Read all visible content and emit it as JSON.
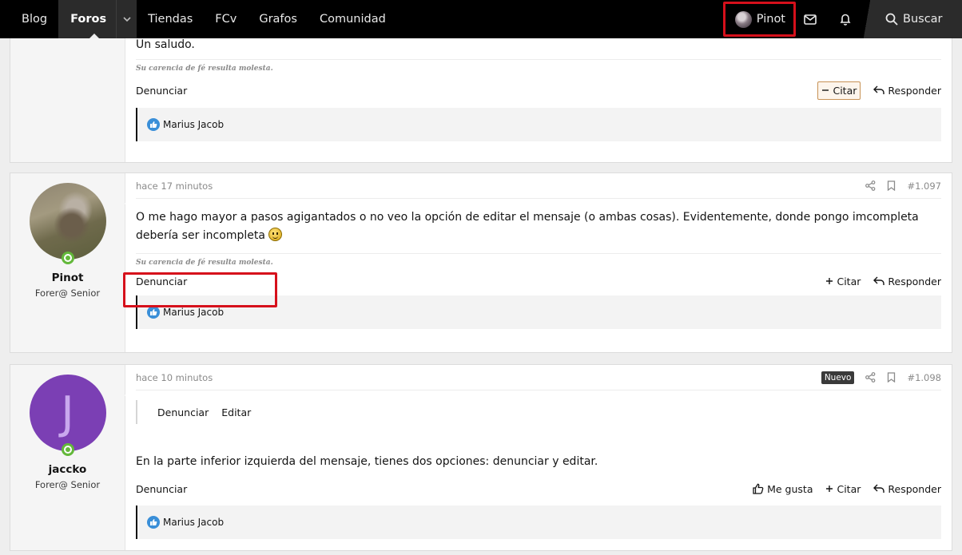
{
  "nav": {
    "items": [
      "Blog",
      "Foros",
      "Tiendas",
      "FCv",
      "Grafos",
      "Comunidad"
    ],
    "active": "Foros",
    "user": "Pinot",
    "search": "Buscar"
  },
  "posts": [
    {
      "message": "Un saludo.",
      "signature": "Su carencia de fé resulta molesta.",
      "report": "Denunciar",
      "quote": "Citar",
      "reply": "Responder",
      "reaction_user": "Marius Jacob"
    },
    {
      "username": "Pinot",
      "user_title": "Forer@ Senior",
      "time": "hace 17 minutos",
      "number": "#1.097",
      "message": "O me hago mayor a pasos agigantados o no veo la opción de editar el mensaje (o ambas cosas). Evidentemente, donde pongo imcompleta debería ser incompleta",
      "signature": "Su carencia de fé resulta molesta.",
      "report": "Denunciar",
      "quote": "Citar",
      "reply": "Responder",
      "reaction_user": "Marius Jacob"
    },
    {
      "username": "jaccko",
      "user_title": "Forer@ Senior",
      "avatar_letter": "J",
      "time": "hace 10 minutos",
      "badge": "Nuevo",
      "number": "#1.098",
      "quoted_menu": [
        "Denunciar",
        "Editar"
      ],
      "message": "En la parte inferior izquierda del mensaje, tienes dos opciones: denunciar y editar.",
      "report": "Denunciar",
      "like": "Me gusta",
      "quote": "Citar",
      "reply": "Responder",
      "reaction_user": "Marius Jacob"
    }
  ],
  "colors": {
    "nav_bg": "#000000",
    "highlight": "#d6101b",
    "avatar_purple": "#7b3fb4",
    "online": "#63b83a"
  }
}
